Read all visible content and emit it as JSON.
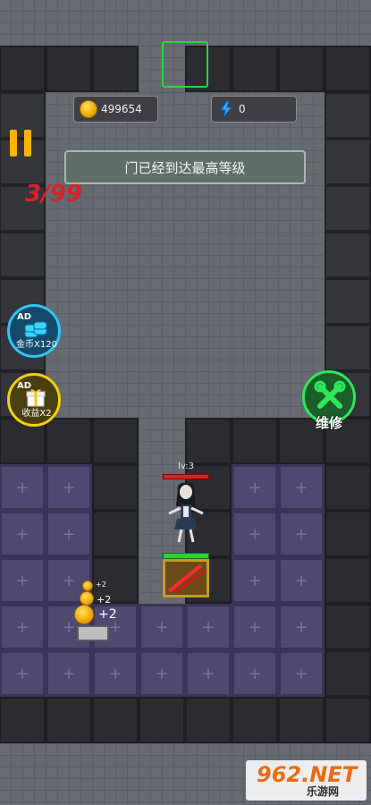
{
  "hud": {
    "coins": "499654",
    "energy": "0",
    "message": "门已经到达最高等级",
    "level_progress": "3/99"
  },
  "side_buttons": {
    "coins_ad": {
      "ad_label": "AD",
      "caption": "金币X120"
    },
    "income_ad": {
      "ad_label": "AD",
      "caption": "收益X2"
    },
    "repair_label": "维修"
  },
  "character": {
    "level_label": "lv:3",
    "health_fraction": 1.0
  },
  "coin_stack": {
    "bonus_small": "+2",
    "bonus_mid": "+2",
    "bonus_large": "+2"
  },
  "watermark": {
    "brand": "962.NET",
    "site": "乐游网"
  },
  "colors": {
    "accent_green": "#27d83b",
    "gold": "#ffb300",
    "level_red": "#d8222a",
    "purple_tile": "#4f4870",
    "ad_blue": "#2fc6f2",
    "ad_gold": "#f4d000"
  }
}
